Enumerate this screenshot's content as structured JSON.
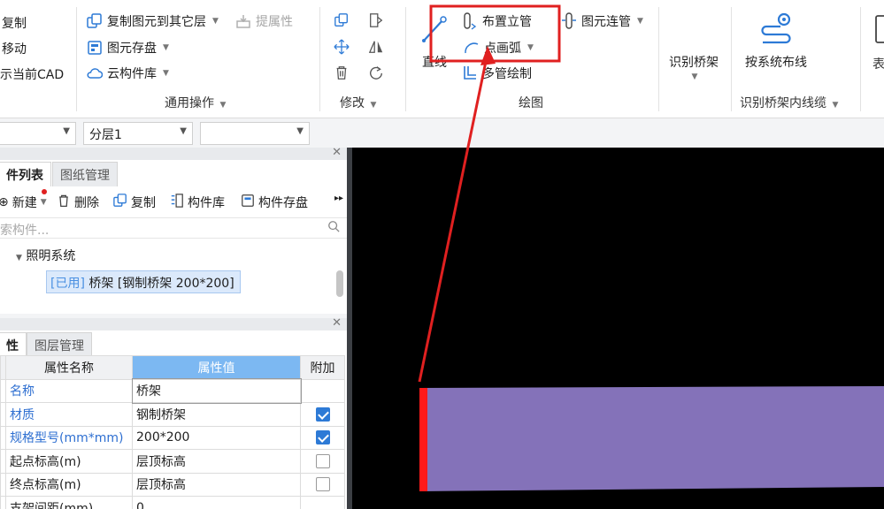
{
  "ribbon": {
    "left_group": {
      "copy": "复制",
      "move": "移动",
      "show_cad": "示当前CAD"
    },
    "general_ops": {
      "copy_to_layer": "复制图元到其它层",
      "extract_props": "提属性",
      "save_element": "图元存盘",
      "cloud_library": "云构件库",
      "label": "通用操作"
    },
    "modify": {
      "label": "修改"
    },
    "draw": {
      "line": "直线",
      "place_riser": "布置立管",
      "arc_partial": "点画弧",
      "multi_pipe": "多管绘制",
      "connect_pipe": "图元连管",
      "label": "绘图"
    },
    "tray": {
      "identify": "识别桥架",
      "route_by_system": "按系统布线",
      "label": "识别桥架内线缆",
      "cut_text": "表"
    }
  },
  "combos": {
    "floor_placeholder": "",
    "layer": "分层1",
    "third": ""
  },
  "component_panel": {
    "tabs": [
      "件列表",
      "图纸管理"
    ],
    "toolbar": {
      "new": "新建",
      "delete": "删除",
      "copy": "复制",
      "library": "构件库",
      "save": "构件存盘"
    },
    "search_placeholder": "索构件...",
    "tree": {
      "root": "照明系统",
      "item_tag": "[已用]",
      "item_label": "桥架 [钢制桥架 200*200]"
    }
  },
  "property_panel": {
    "tabs": [
      "性",
      "图层管理"
    ],
    "headers": [
      "属性名称",
      "属性值",
      "附加"
    ],
    "rows": [
      {
        "name": "名称",
        "value": "桥架",
        "checked": null,
        "link": true
      },
      {
        "name": "材质",
        "value": "钢制桥架",
        "checked": true,
        "link": true
      },
      {
        "name": "规格型号(mm*mm)",
        "value": "200*200",
        "checked": true,
        "link": true
      },
      {
        "name": "起点标高(m)",
        "value": "层顶标高",
        "checked": false,
        "link": false
      },
      {
        "name": "终点标高(m)",
        "value": "层顶标高",
        "checked": false,
        "link": false
      },
      {
        "name": "支架间距(mm)",
        "value": "0",
        "checked": null,
        "link": false
      }
    ]
  },
  "colors": {
    "highlight_box": "#e02020",
    "tray_fill": "#8472b9",
    "tray_end": "#ff1a1a",
    "header_highlight": "#7cb8f2"
  }
}
